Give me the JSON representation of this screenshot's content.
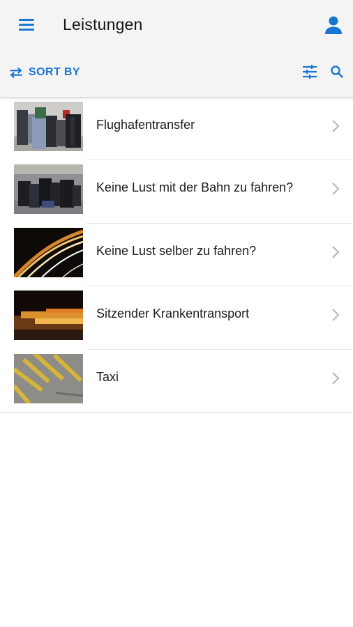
{
  "header": {
    "title": "Leistungen",
    "menu_icon": "menu-icon",
    "user_icon": "user-icon"
  },
  "toolbar": {
    "sort_label": "SORT BY",
    "sort_icon": "swap-arrows-icon",
    "filter_icon": "tune-icon",
    "search_icon": "search-icon"
  },
  "services": [
    {
      "label": "Flughafentransfer",
      "thumbnail": "luggage-photo"
    },
    {
      "label": "Keine Lust mit der Bahn zu fahren?",
      "thumbnail": "suitcases-on-platform-photo"
    },
    {
      "label": "Keine Lust selber zu fahren?",
      "thumbnail": "highway-light-trails-photo"
    },
    {
      "label": "Sitzender Krankentransport",
      "thumbnail": "motion-blur-vehicle-photo"
    },
    {
      "label": "Taxi",
      "thumbnail": "taxi-road-marking-photo"
    }
  ],
  "colors": {
    "accent": "#1976d2",
    "header_bg": "#f4f4f4",
    "chevron": "#b5b5b5"
  }
}
